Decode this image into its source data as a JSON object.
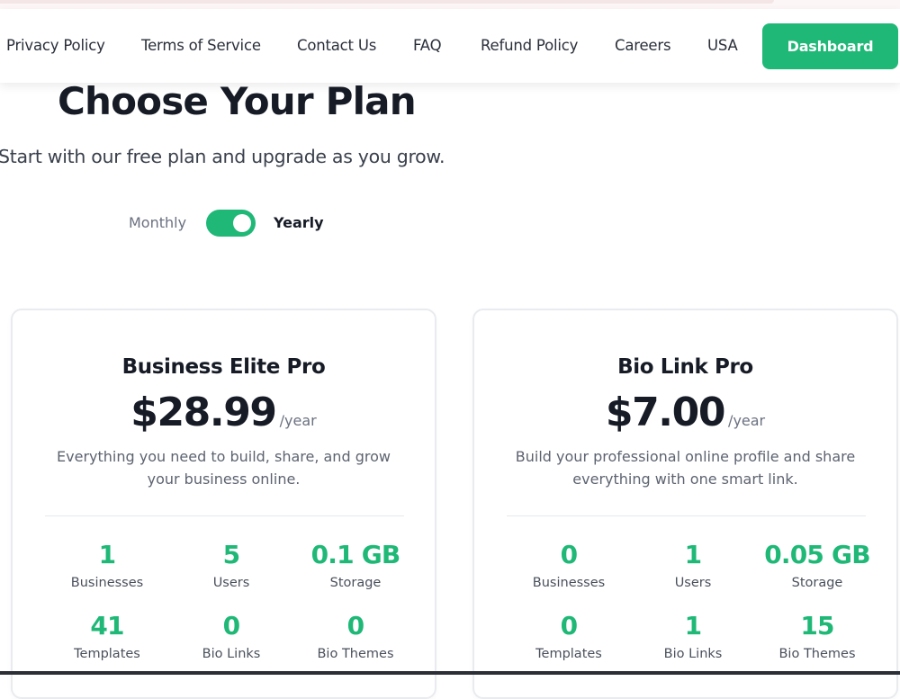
{
  "nav": {
    "links": [
      "Privacy Policy",
      "Terms of Service",
      "Contact Us",
      "FAQ",
      "Refund Policy",
      "Careers",
      "USA"
    ],
    "dashboard_label": "Dashboard"
  },
  "hero": {
    "title": "Choose Your Plan",
    "subtitle": "Start with our free plan and upgrade as you grow."
  },
  "billing": {
    "monthly_label": "Monthly",
    "yearly_label": "Yearly",
    "selected": "Yearly"
  },
  "plans": [
    {
      "name": "Business Elite Pro",
      "price": "$28.99",
      "period": "/year",
      "description": "Everything you need to build, share, and grow your business online.",
      "stats": [
        {
          "value": "1",
          "label": "Businesses"
        },
        {
          "value": "5",
          "label": "Users"
        },
        {
          "value": "0.1 GB",
          "label": "Storage"
        },
        {
          "value": "41",
          "label": "Templates"
        },
        {
          "value": "0",
          "label": "Bio Links"
        },
        {
          "value": "0",
          "label": "Bio Themes"
        }
      ]
    },
    {
      "name": "Bio Link Pro",
      "price": "$7.00",
      "period": "/year",
      "description": "Build your professional online profile and share everything with one smart link.",
      "stats": [
        {
          "value": "0",
          "label": "Businesses"
        },
        {
          "value": "1",
          "label": "Users"
        },
        {
          "value": "0.05 GB",
          "label": "Storage"
        },
        {
          "value": "0",
          "label": "Templates"
        },
        {
          "value": "1",
          "label": "Bio Links"
        },
        {
          "value": "15",
          "label": "Bio Themes"
        }
      ]
    }
  ],
  "colors": {
    "accent": "#1fb877",
    "heading": "#161b26",
    "muted": "#6b7180"
  }
}
